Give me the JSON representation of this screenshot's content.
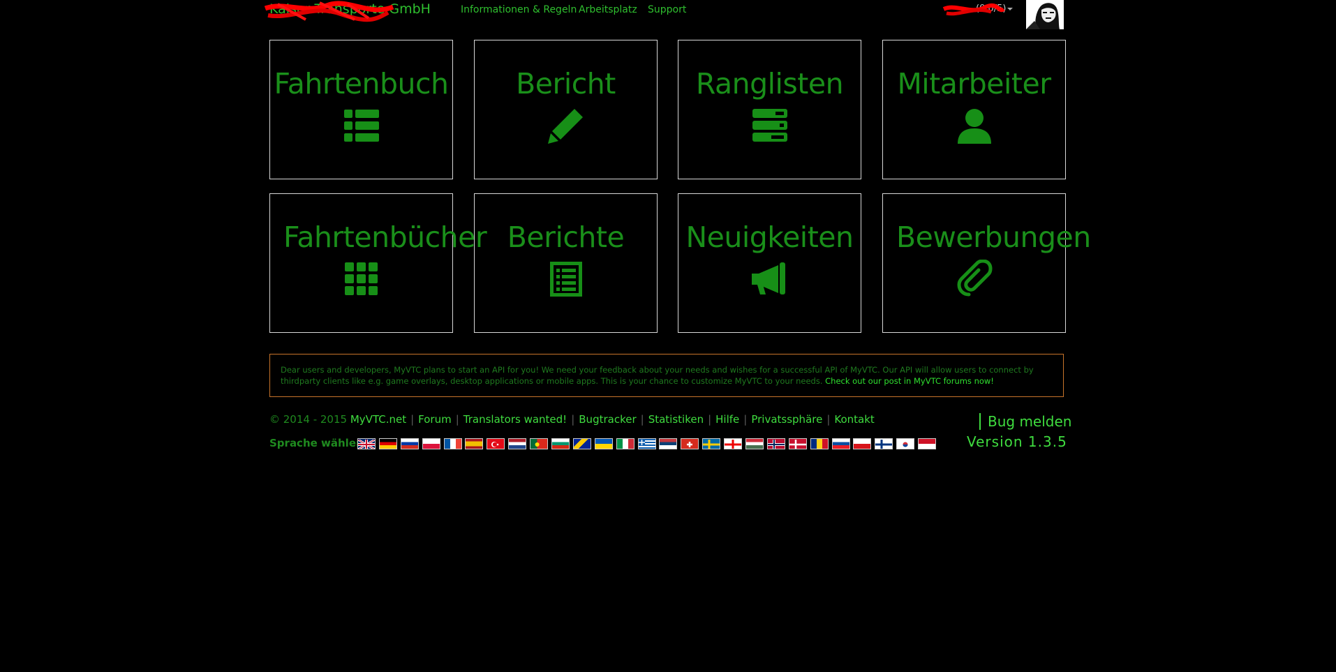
{
  "navbar": {
    "brand": "Kaiser Transporte GmbH",
    "links": [
      "Informationen & Regeln",
      "Arbeitsplatz",
      "Support"
    ],
    "user_label": "(0.0/5)"
  },
  "tiles": [
    {
      "label": "Fahrtenbuch",
      "icon": "list-icon"
    },
    {
      "label": "Bericht",
      "icon": "pencil-icon"
    },
    {
      "label": "Ranglisten",
      "icon": "tasks-icon"
    },
    {
      "label": "Mitarbeiter",
      "icon": "user-icon"
    },
    {
      "label": "Fahrtenbücher",
      "icon": "grid-icon"
    },
    {
      "label": "Berichte",
      "icon": "list-alt-icon"
    },
    {
      "label": "Neuigkeiten",
      "icon": "bullhorn-icon"
    },
    {
      "label": "Bewerbungen",
      "icon": "paperclip-icon"
    }
  ],
  "notice": {
    "text": "Dear users and developers, MyVTC plans to start an API for you! We need your feedback about your needs and wishes for a successful API of MyVTC. Our API will allow users to connect by thirdparty clients like e.g. game overlays, desktop applications or mobile apps. This is your chance to customize MyVTC to your needs.",
    "cta": "Check out our post in MyVTC forums now!"
  },
  "footer": {
    "copyright": "© 2014 - 2015",
    "links": [
      "MyVTC.net",
      "Forum",
      "Translators wanted!",
      "Bugtracker",
      "Statistiken",
      "Hilfe",
      "Privatssphäre",
      "Kontakt"
    ],
    "language_label": "Sprache wählen:",
    "flags": [
      "uk",
      "de",
      "ru",
      "pl",
      "fr",
      "es",
      "tr",
      "nl",
      "pt",
      "bg",
      "ba",
      "ua",
      "it",
      "gr",
      "rs",
      "ch",
      "se",
      "ge",
      "hu",
      "no",
      "dk",
      "ro",
      "sk",
      "cz",
      "fi",
      "kr",
      "id"
    ],
    "bug_button": "Bug melden",
    "version": "Version 1.3.5"
  },
  "colors": {
    "accent": "#1a8f1a",
    "link": "#3fdc3f",
    "notice_border": "#c8742a"
  }
}
